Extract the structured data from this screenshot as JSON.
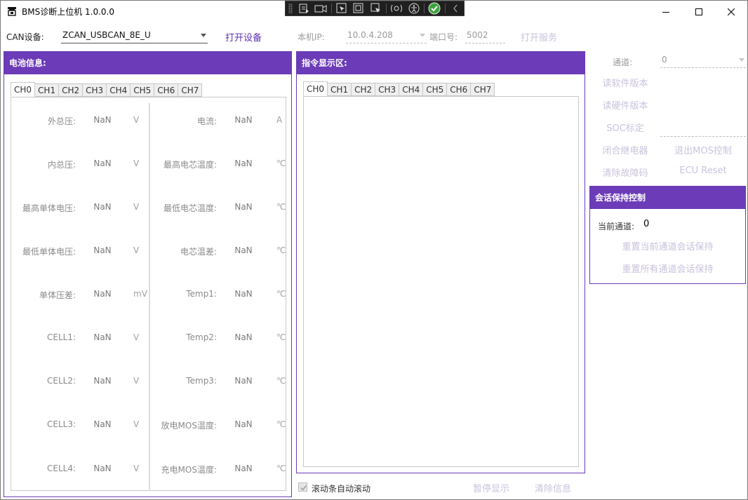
{
  "window": {
    "title": "BMS诊断上位机 1.0.0.0",
    "controls": [
      "minimize-icon",
      "maximize-icon",
      "close-icon"
    ]
  },
  "debug_toolbar": {
    "icons": [
      "live-visual-tree-icon",
      "record-icon",
      "select-element-icon",
      "display-layout-adorners-icon",
      "track-focus-icon",
      "binding-failures-icon",
      "accessibility-icon",
      "check-status-icon",
      "collapse-chevron-icon"
    ]
  },
  "top": {
    "can_label": "CAN设备:",
    "can_value": "ZCAN_USBCAN_8E_U",
    "open_device": "打开设备",
    "ip_label": "本机IP:",
    "ip_value": "10.0.4.208",
    "port_label": "端口号:",
    "port_value": "5002",
    "open_service": "打开服务"
  },
  "battery": {
    "header": "电池信息:",
    "tabs": [
      "CH0",
      "CH1",
      "CH2",
      "CH3",
      "CH4",
      "CH5",
      "CH6",
      "CH7"
    ],
    "active_tab": "CH0",
    "left": [
      {
        "name": "外总压:",
        "value": "NaN",
        "unit": "V"
      },
      {
        "name": "内总压:",
        "value": "NaN",
        "unit": "V"
      },
      {
        "name": "最高单体电压:",
        "value": "NaN",
        "unit": "V"
      },
      {
        "name": "最低单体电压:",
        "value": "NaN",
        "unit": "V"
      },
      {
        "name": "单体压差:",
        "value": "NaN",
        "unit": "mV"
      },
      {
        "name": "CELL1:",
        "value": "NaN",
        "unit": "V"
      },
      {
        "name": "CELL2:",
        "value": "NaN",
        "unit": "V"
      },
      {
        "name": "CELL3:",
        "value": "NaN",
        "unit": "V"
      },
      {
        "name": "CELL4:",
        "value": "NaN",
        "unit": "V"
      }
    ],
    "right": [
      {
        "name": "电流:",
        "value": "NaN",
        "unit": "A"
      },
      {
        "name": "最高电芯温度:",
        "value": "NaN",
        "unit": "℃"
      },
      {
        "name": "最低电芯温度:",
        "value": "NaN",
        "unit": "℃"
      },
      {
        "name": "电芯温差:",
        "value": "NaN",
        "unit": "℃"
      },
      {
        "name": "Temp1:",
        "value": "NaN",
        "unit": "℃"
      },
      {
        "name": "Temp2:",
        "value": "NaN",
        "unit": "℃"
      },
      {
        "name": "Temp3:",
        "value": "NaN",
        "unit": "℃"
      },
      {
        "name": "放电MOS温度:",
        "value": "NaN",
        "unit": "℃"
      },
      {
        "name": "充电MOS温度:",
        "value": "NaN",
        "unit": "℃"
      }
    ]
  },
  "command": {
    "header": "指令显示区:",
    "tabs": [
      "CH0",
      "CH1",
      "CH2",
      "CH3",
      "CH4",
      "CH5",
      "CH6",
      "CH7"
    ],
    "active_tab": "CH0",
    "autoscroll_label": "滚动条自动滚动",
    "autoscroll_checked": true,
    "pause": "暂停显示",
    "clear": "清除信息"
  },
  "control": {
    "channel_label": "通道:",
    "channel_value": "0",
    "read_sw": "读软件版本",
    "read_hw": "读硬件版本",
    "soc": "SOC标定",
    "close_relay": "闭合继电器",
    "exit_mos": "退出MOS控制",
    "clear_fault": "清除故障码",
    "ecu_reset": "ECU Reset"
  },
  "session": {
    "header": "会话保持控制",
    "current_label": "当前通道:",
    "current_value": "0",
    "reset_current": "重置当前通道会话保持",
    "reset_all": "重置所有通道会话保持"
  },
  "colors": {
    "accent": "#6b3bb8",
    "disabled_text": "#c9c2dc"
  }
}
